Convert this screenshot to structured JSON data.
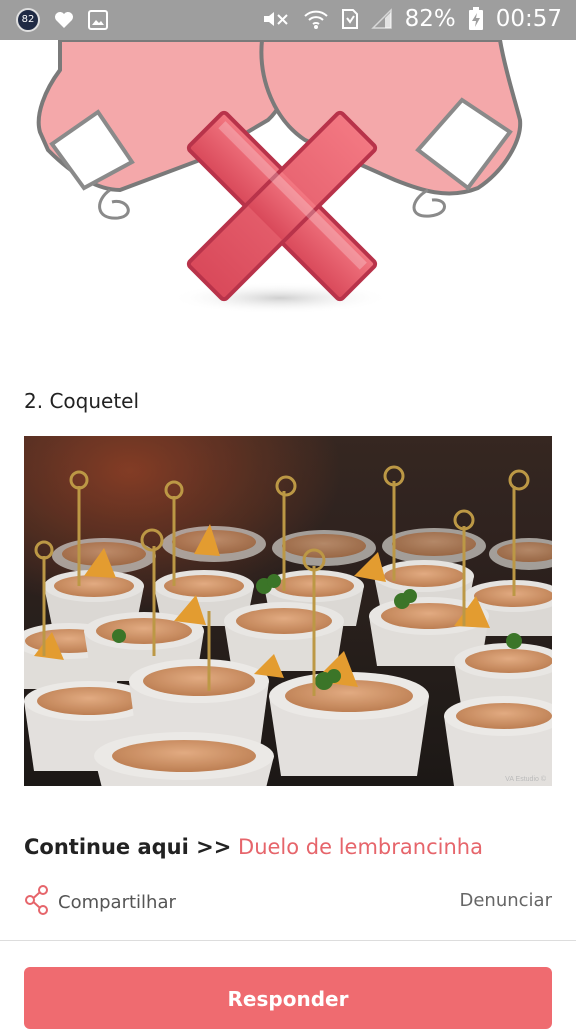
{
  "status_bar": {
    "notification_badge": "82",
    "battery": "82%",
    "time": "00:57",
    "icons": [
      "notification-badge-icon",
      "heart-icon",
      "image-icon",
      "mute-icon",
      "wifi-icon",
      "sim-icon",
      "signal-icon",
      "battery-charging-icon"
    ]
  },
  "post": {
    "illustration_icon": "broken-heart-x-illustration",
    "item_heading": "2. Coquetel",
    "photo_credit": "VA Estudio ©",
    "continue_label": "Continue aqui >>",
    "continue_link": "Duelo de lembrancinha",
    "share_label": "Compartilhar",
    "report_label": "Denunciar",
    "reply_label": "Responder"
  },
  "colors": {
    "accent": "#ef6b70",
    "link": "#e6656b",
    "status_bar": "#9e9e9e"
  }
}
